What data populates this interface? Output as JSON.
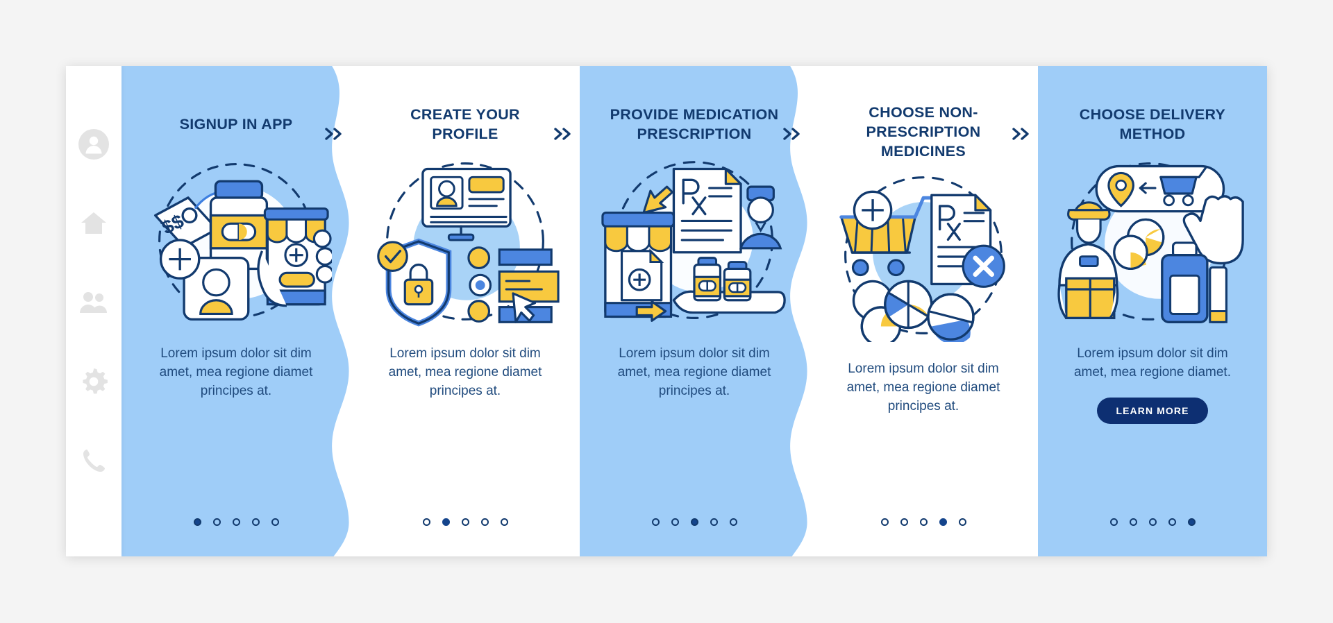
{
  "app": {
    "background_color": "#f4f4f4",
    "card_blue": "#9fcdf8",
    "card_white": "#ffffff",
    "title_color": "#123a6e",
    "accent_yellow": "#f6c game",
    "button_color": "#0d2f72"
  },
  "sidebar": {
    "items": [
      {
        "name": "avatar-icon",
        "label": "Profile"
      },
      {
        "name": "home-icon",
        "label": "Home"
      },
      {
        "name": "people-icon",
        "label": "Community"
      },
      {
        "name": "gear-icon",
        "label": "Settings"
      },
      {
        "name": "phone-icon",
        "label": "Contact"
      }
    ]
  },
  "separators": [
    {
      "glyph": "»"
    },
    {
      "glyph": "»"
    },
    {
      "glyph": "»"
    },
    {
      "glyph": "»"
    }
  ],
  "cards": [
    {
      "index": 1,
      "theme": "blue",
      "title": "SIGNUP IN APP",
      "body": "Lorem ipsum dolor sit dim amet, mea regione diamet principes at.",
      "illustration": "signup-in-app-illustration",
      "dots": {
        "count": 5,
        "active": 1
      },
      "cta": null
    },
    {
      "index": 2,
      "theme": "white",
      "title": "CREATE YOUR PROFILE",
      "body": "Lorem ipsum dolor sit dim amet, mea regione diamet principes at.",
      "illustration": "create-profile-illustration",
      "dots": {
        "count": 5,
        "active": 2
      },
      "cta": null
    },
    {
      "index": 3,
      "theme": "blue",
      "title": "PROVIDE MEDICATION PRESCRIPTION",
      "body": "Lorem ipsum dolor sit dim amet, mea regione diamet principes at.",
      "illustration": "provide-prescription-illustration",
      "dots": {
        "count": 5,
        "active": 3
      },
      "cta": null
    },
    {
      "index": 4,
      "theme": "white",
      "title": "CHOOSE NON-PRESCRIPTION MEDICINES",
      "body": "Lorem ipsum dolor sit dim amet, mea regione diamet principes at.",
      "illustration": "choose-non-prescription-illustration",
      "dots": {
        "count": 5,
        "active": 4
      },
      "cta": null
    },
    {
      "index": 5,
      "theme": "blue",
      "title": "CHOOSE DELIVERY METHOD",
      "body": "Lorem ipsum dolor sit dim amet, mea regione diamet.",
      "illustration": "choose-delivery-illustration",
      "dots": {
        "count": 5,
        "active": 5
      },
      "cta": "LEARN MORE"
    }
  ]
}
